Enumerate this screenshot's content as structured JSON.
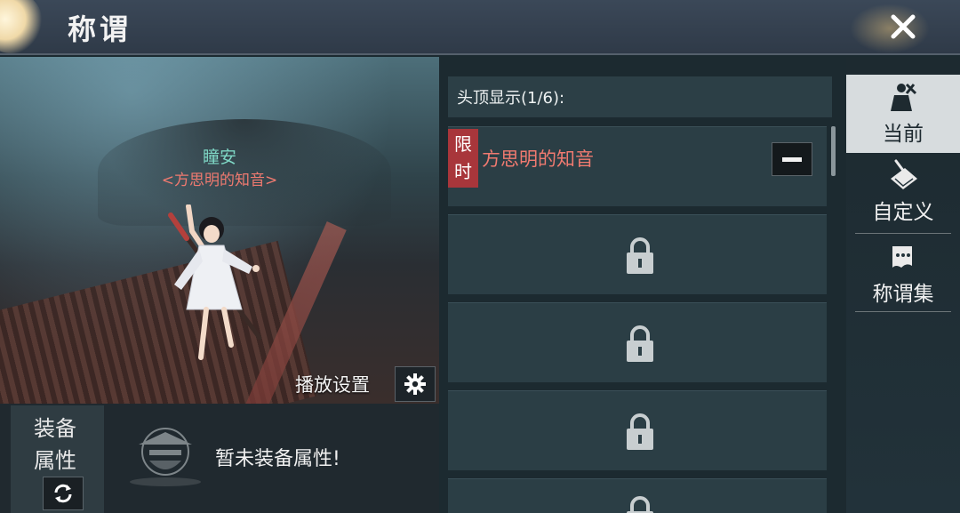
{
  "header": {
    "title": "称谓",
    "close_icon": "close-icon"
  },
  "preview": {
    "character_name": "瞳安",
    "character_title": "<方思明的知音>",
    "play_settings_label": "播放设置",
    "settings_icon": "gear-icon"
  },
  "equip": {
    "tab_label_line1": "装备",
    "tab_label_line2": "属性",
    "swap_icon": "refresh-icon",
    "empty_text": "暂未装备属性!"
  },
  "slot_list": {
    "header": "头顶显示(1/6):",
    "slots": [
      {
        "tag_line1": "限",
        "tag_line2": "时",
        "title": "方思明的知音",
        "action_icon": "minus-icon"
      },
      {
        "state": "locked",
        "icon": "lock-icon"
      },
      {
        "state": "locked",
        "icon": "lock-icon"
      },
      {
        "state": "locked",
        "icon": "lock-icon"
      },
      {
        "state": "locked",
        "icon": "lock-icon"
      }
    ]
  },
  "side_tabs": [
    {
      "label": "当前",
      "icon": "character-icon",
      "active": true
    },
    {
      "label": "自定义",
      "icon": "edit-paper-icon",
      "active": false
    },
    {
      "label": "称谓集",
      "icon": "scroll-icon",
      "active": false
    }
  ],
  "colors": {
    "title_red": "#f07a70",
    "name_teal": "#7fd8c6",
    "limited_tag_red": "#a8363b",
    "active_tab_bg": "#d7dcde"
  }
}
